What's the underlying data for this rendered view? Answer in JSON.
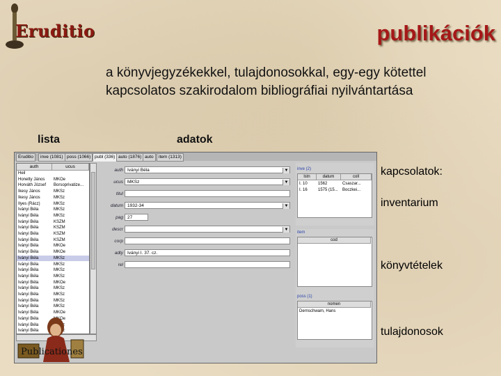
{
  "logo": {
    "text": "Eruditio"
  },
  "title": "publikációk",
  "subtitle": "a könyvjegyzékekkel, tulajdonosokkal, egy-egy kötettel kapcsolatos szakirodalom bibliográfiai nyilvántartása",
  "labels": {
    "lista": "lista",
    "adatok": "adatok"
  },
  "right_labels": [
    "kapcsolatok:",
    "inventarium",
    "könyvtételek",
    "tulajdonosok"
  ],
  "app": {
    "tabs": [
      "Eruditio",
      "inve (1081)",
      "poss (1066)",
      "publ (336)",
      "auto (1876)",
      "auto",
      "item (1313)"
    ],
    "list_headers": [
      "auth",
      "ucus"
    ],
    "list_rows": [
      [
        "Heil",
        ""
      ],
      [
        "Honetty János",
        "MKOe"
      ],
      [
        "Horváth József",
        "Borsoprivatize..."
      ],
      [
        "Ikesy János",
        "MKSz"
      ],
      [
        "Ikesy János",
        "MKSz"
      ],
      [
        "Ilyes (Rácz)",
        "MKSz"
      ],
      [
        "Iványi Béla",
        "MKSz"
      ],
      [
        "Iványi Béla",
        "MKSz"
      ],
      [
        "Iványi Béla",
        "KSZM"
      ],
      [
        "Iványi Béla",
        "KSZM"
      ],
      [
        "Iványi Béla",
        "KSZM"
      ],
      [
        "Iványi Béla",
        "KSZM"
      ],
      [
        "Iványi Béla",
        "MKOe"
      ],
      [
        "Iványi Béla",
        "MKOe"
      ],
      [
        "Iványi Béla",
        "MKSz"
      ],
      [
        "Iványi Béla",
        "MKSz"
      ],
      [
        "Iványi Béla",
        "MKSz"
      ],
      [
        "Iványi Béla",
        "MKSz"
      ],
      [
        "Iványi Béla",
        "MKOe"
      ],
      [
        "Iványi Béla",
        "MKSz"
      ],
      [
        "Iványi Béla",
        "MKSz"
      ],
      [
        "Iványi Béla",
        "MKSz"
      ],
      [
        "Iványi Béla",
        "MKSz"
      ],
      [
        "Iványi Béla",
        "MKOe"
      ],
      [
        "Iványi Béla",
        "MKOe"
      ],
      [
        "Iványi Béla",
        "MKSz"
      ],
      [
        "Iványi Béla",
        "MKSz"
      ]
    ],
    "selected_row": 14,
    "form": [
      {
        "label": "auth",
        "value": "Iványi Béla",
        "dropdown": true
      },
      {
        "label": "ucus",
        "value": "MKSz",
        "dropdown": true
      },
      {
        "label": "titul",
        "value": "",
        "dropdown": false
      },
      {
        "label": "datum",
        "value": "1932-34",
        "dropdown": true
      },
      {
        "label": "pag",
        "value": "27",
        "dropdown": false,
        "short": true
      },
      {
        "label": "descr",
        "value": "",
        "dropdown": true
      },
      {
        "label": "corp",
        "value": "",
        "dropdown": false
      },
      {
        "label": "adty",
        "value": "Iványi I. 37. cz.",
        "dropdown": false
      },
      {
        "label": "rel",
        "value": "",
        "dropdown": false
      }
    ],
    "inve": {
      "label": "inve (2)",
      "headers": [
        "lstn",
        "datum",
        "coll"
      ],
      "rows": [
        [
          "I. 10",
          "1562",
          "Csaszar..."
        ],
        [
          "I. 16",
          "1575 (15...",
          "Boczkei..."
        ]
      ]
    },
    "item": {
      "label": "item",
      "headers": [
        "cod"
      ]
    },
    "poss": {
      "label": "poss (1)",
      "headers": [
        "nomen"
      ],
      "rows": [
        [
          "Dernschwam, Hans"
        ]
      ]
    }
  },
  "scholar": {
    "text": "Publicationes"
  }
}
